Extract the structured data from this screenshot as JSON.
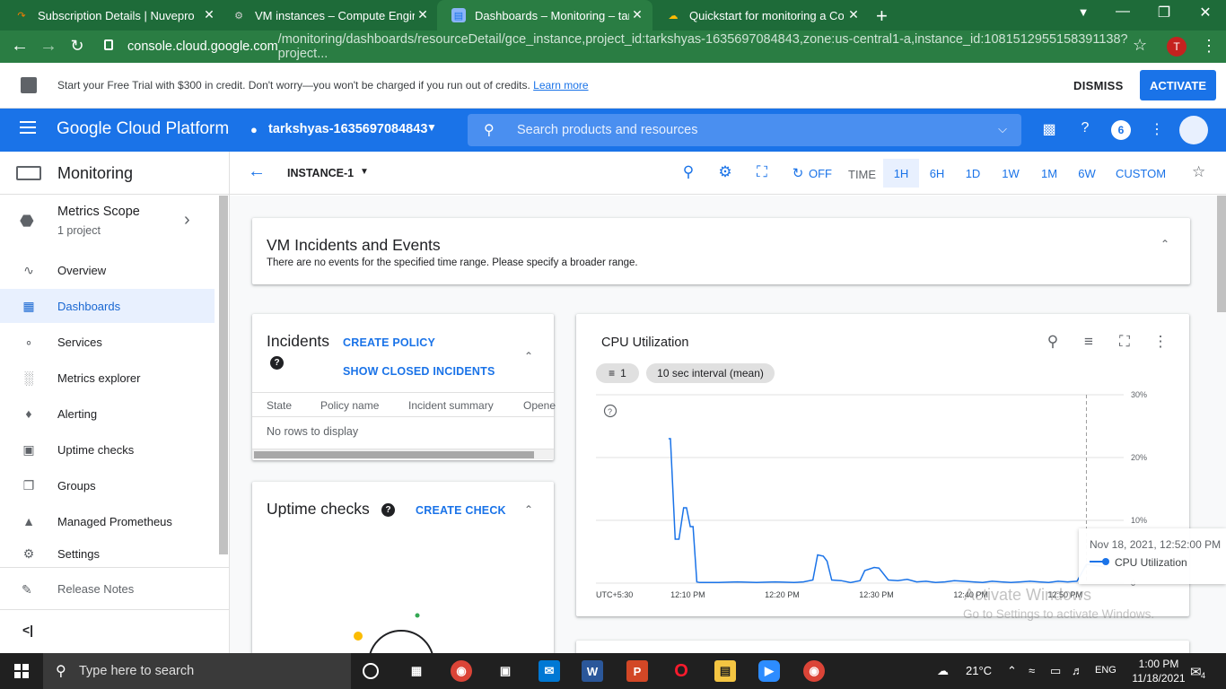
{
  "browser": {
    "tabs": [
      {
        "title": "Subscription Details | Nuvepro",
        "icon": "nuvepro-favicon",
        "color": "#f57c00"
      },
      {
        "title": "VM instances – Compute Engine",
        "icon": "compute-engine-favicon",
        "color": "#bdbdbd"
      },
      {
        "title": "Dashboards – Monitoring – tarks",
        "icon": "monitoring-favicon",
        "color": "#4285f4"
      },
      {
        "title": "Quickstart for monitoring a Com",
        "icon": "google-cloud-favicon",
        "color": "#fbbc04"
      }
    ],
    "url_host": "console.cloud.google.com",
    "url_path": "/monitoring/dashboards/resourceDetail/gce_instance,project_id:tarkshyas-1635697084843,zone:us-central1-a,instance_id:1081512955158391138?project...",
    "profile_initial": "T"
  },
  "trial_banner": {
    "message": "Start your Free Trial with $300 in credit. Don't worry—you won't be charged if you run out of credits.",
    "learn_more": "Learn more",
    "dismiss": "DISMISS",
    "activate": "ACTIVATE"
  },
  "header": {
    "brand": "Google Cloud Platform",
    "project": "tarkshyas-1635697084843",
    "search_placeholder": "Search products and resources",
    "notifications": "6"
  },
  "sidebar": {
    "title": "Monitoring",
    "scope_title": "Metrics Scope",
    "scope_sub": "1 project",
    "items": [
      {
        "label": "Overview",
        "icon": "overview-icon",
        "selected": false
      },
      {
        "label": "Dashboards",
        "icon": "dashboards-icon",
        "selected": true
      },
      {
        "label": "Services",
        "icon": "services-icon",
        "selected": false
      },
      {
        "label": "Metrics explorer",
        "icon": "metrics-explorer-icon",
        "selected": false
      },
      {
        "label": "Alerting",
        "icon": "bell-icon",
        "selected": false
      },
      {
        "label": "Uptime checks",
        "icon": "uptime-icon",
        "selected": false
      },
      {
        "label": "Groups",
        "icon": "groups-icon",
        "selected": false
      },
      {
        "label": "Managed Prometheus",
        "icon": "prometheus-icon",
        "selected": false
      },
      {
        "label": "Settings",
        "icon": "gear-icon",
        "selected": false
      }
    ],
    "release_notes": "Release Notes"
  },
  "toolbar": {
    "instance": "INSTANCE-1",
    "refresh": "OFF",
    "time_label": "TIME",
    "ranges": [
      "1H",
      "6H",
      "1D",
      "1W",
      "1M",
      "6W",
      "CUSTOM"
    ],
    "selected_range": "1H"
  },
  "vm_events": {
    "title": "VM Incidents and Events",
    "message": "There are no events for the specified time range. Please specify a broader range."
  },
  "incidents": {
    "title": "Incidents",
    "create_policy": "CREATE POLICY",
    "show_closed": "SHOW CLOSED INCIDENTS",
    "columns": [
      "State",
      "Policy name",
      "Incident summary",
      "Opene"
    ],
    "empty": "No rows to display"
  },
  "uptime": {
    "title": "Uptime checks",
    "create_check": "CREATE CHECK"
  },
  "cpu": {
    "title": "CPU Utilization",
    "filter_count": "1",
    "interval": "10 sec interval (mean)",
    "tooltip_date": "Nov 18, 2021, 12:52:00 PM",
    "tooltip_series": "CPU Utilization"
  },
  "chart_data": {
    "type": "line",
    "title": "CPU Utilization",
    "xlabel": "",
    "ylabel": "",
    "timezone_label": "UTC+5:30",
    "x_ticks": [
      "12:10 PM",
      "12:20 PM",
      "12:30 PM",
      "12:40 PM",
      "12:50 PM"
    ],
    "y_ticks": [
      "0",
      "10%",
      "20%",
      "30%"
    ],
    "ylim": [
      0,
      30
    ],
    "series": [
      {
        "name": "CPU Utilization",
        "color": "#1a73e8",
        "x_minutes": [
          7.7,
          7.9,
          8.4,
          8.8,
          9.3,
          9.6,
          10.0,
          10.3,
          10.7,
          11.0,
          11.5,
          13,
          15,
          17,
          19,
          21,
          22,
          23,
          23.5,
          24.1,
          24.5,
          25,
          26,
          27,
          28,
          28.5,
          29.5,
          30,
          31,
          32,
          33,
          34,
          35,
          36,
          37,
          38,
          39,
          40,
          41,
          42,
          43,
          44,
          45,
          46,
          47,
          48,
          49,
          50,
          51,
          52,
          53,
          54
        ],
        "y_percent": [
          23,
          23,
          7,
          7,
          12,
          12,
          9,
          9,
          0.2,
          0.1,
          0.1,
          0.1,
          0.2,
          0.1,
          0.2,
          0.1,
          0.2,
          0.5,
          4.5,
          4.3,
          3.5,
          0.5,
          0.4,
          0.1,
          0.4,
          2.0,
          2.5,
          2.4,
          0.5,
          0.4,
          0.6,
          0.2,
          0.3,
          0.1,
          0.2,
          0.4,
          0.3,
          0.2,
          0.1,
          0.3,
          0.2,
          0.1,
          0.2,
          0.3,
          0.2,
          0.1,
          0.3,
          0.2,
          0.3,
          3.0,
          2.8,
          2.6
        ]
      }
    ],
    "cursor_time": "12:52:00 PM",
    "grid": true
  },
  "watermark": {
    "line1": "Activate Windows",
    "line2": "Go to Settings to activate Windows."
  },
  "taskbar": {
    "search_placeholder": "Type here to search",
    "temperature": "21°C",
    "language": "ENG",
    "time": "1:00 PM",
    "date": "11/18/2021",
    "notification_count": "4"
  }
}
